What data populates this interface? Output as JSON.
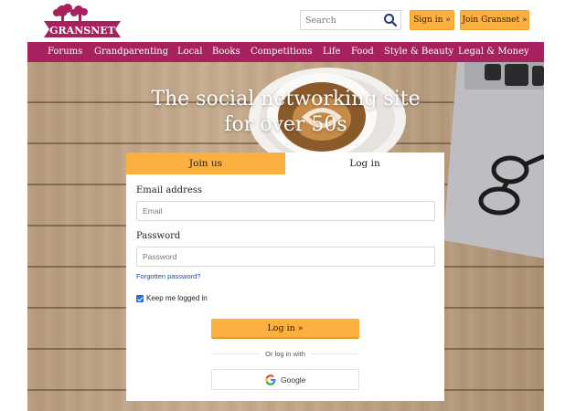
{
  "header": {
    "logo_text": "GRANSNET",
    "search": {
      "placeholder": "Search",
      "value": ""
    },
    "sign_in_label": "Sign in »",
    "join_label": "Join Gransnet »"
  },
  "nav": {
    "items": [
      {
        "label": "Forums"
      },
      {
        "label": "Grandparenting"
      },
      {
        "label": "Local"
      },
      {
        "label": "Books"
      },
      {
        "label": "Competitions"
      },
      {
        "label": "Life"
      },
      {
        "label": "Food"
      },
      {
        "label": "Style & Beauty"
      },
      {
        "label": "Legal & Money"
      }
    ]
  },
  "hero": {
    "headline_line1": "The social networking site",
    "headline_line2": "for over 50s"
  },
  "login_card": {
    "tabs": [
      {
        "label": "Join us",
        "active": false
      },
      {
        "label": "Log in",
        "active": true
      }
    ],
    "email": {
      "label": "Email address",
      "placeholder": "Email",
      "value": ""
    },
    "password": {
      "label": "Password",
      "placeholder": "Password",
      "value": ""
    },
    "forgot_label": "Forgotten password?",
    "keep_logged_in": {
      "label": "Keep me logged in",
      "checked": true
    },
    "submit_label": "Log in »",
    "or_text": "Or log in with",
    "google_label": "Google"
  },
  "colors": {
    "brand_purple": "#a6215e",
    "accent_orange": "#fbb040",
    "link_blue": "#2a4d8f",
    "search_icon": "#1f3a6b"
  },
  "icons": [
    "gransnet-logo",
    "search-icon",
    "check-icon",
    "google-icon"
  ]
}
